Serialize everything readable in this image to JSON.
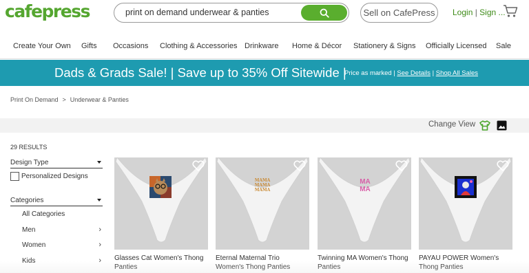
{
  "header": {
    "logo": "cafepress",
    "search_value": "print on demand underwear & panties",
    "sell_label": "Sell on CafePress",
    "login_label": "Login",
    "signup_label": "Sign ...",
    "icons": [
      "search-icon",
      "cart-icon"
    ]
  },
  "nav": {
    "items": [
      "Create Your Own",
      "Gifts",
      "Occasions",
      "Clothing & Accessories",
      "Drinkware",
      "Home & Décor",
      "Stationery & Signs",
      "Officially Licensed",
      "Sale"
    ]
  },
  "promo": {
    "headline": "Dads & Grads Sale! | Save up to 35% Off Sitewide |",
    "price_note": "Price as marked",
    "see_details": "See Details",
    "shop_all": "Shop All Sales",
    "color": "#1e9bb0"
  },
  "breadcrumb": [
    "Print On Demand",
    "Underwear & Panties"
  ],
  "viewbar": {
    "change_view": "Change View",
    "icons": [
      "tshirt-view-icon",
      "image-view-icon"
    ]
  },
  "sidebar": {
    "results": "29 RESULTS",
    "design_type": "Design Type",
    "personalized": "Personalized Designs",
    "categories": "Categories",
    "category_items": [
      "All Categories",
      "Men",
      "Women",
      "Kids"
    ]
  },
  "products": [
    {
      "title": "Glasses Cat Women's Thong Panties"
    },
    {
      "title": "Eternal Maternal Trio Women's Thong Panties",
      "design_text": "MAMA MAMA MAMA"
    },
    {
      "title": "Twinning MA Women's Thong Panties",
      "design_text": "MA MA"
    },
    {
      "title": "PAYAU POWER Women's Thong Panties"
    }
  ],
  "colors": {
    "brand_green": "#55a630",
    "button_green": "#5aae2e",
    "card_bg": "#d3d3d3"
  }
}
